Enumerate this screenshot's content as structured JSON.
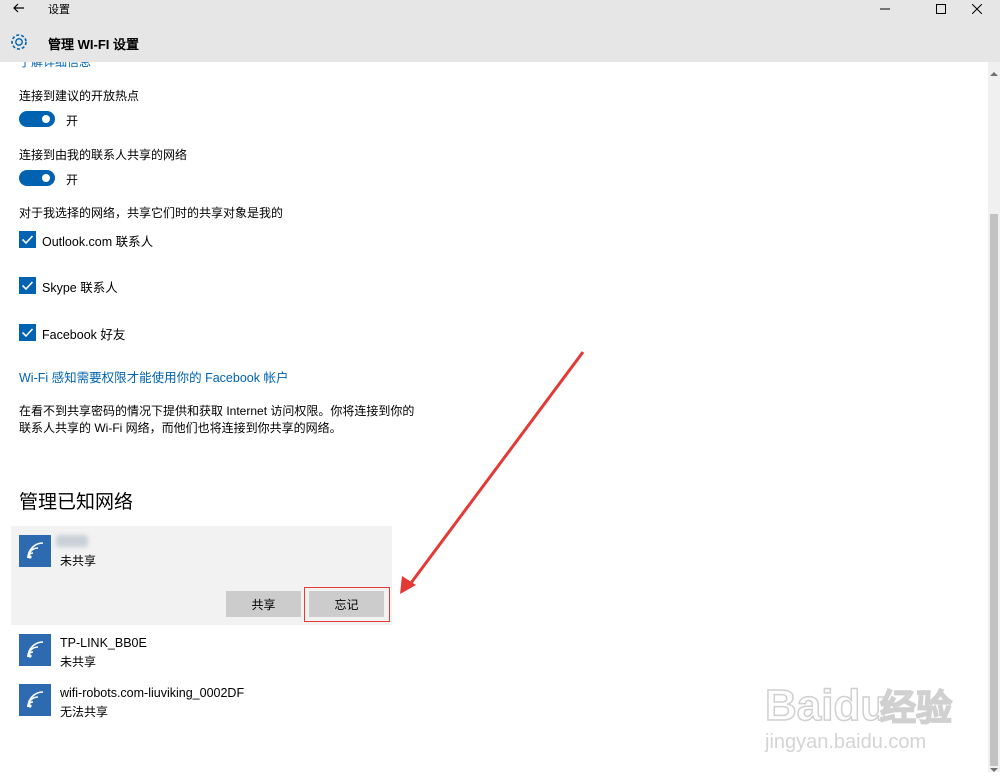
{
  "window": {
    "title": "设置"
  },
  "header": {
    "title": "管理 WI-FI 设置"
  },
  "settings": {
    "cut_link": "了解详细信息",
    "hotspot_label": "连接到建议的开放热点",
    "hotspot_state": "开",
    "contacts_label": "连接到由我的联系人共享的网络",
    "contacts_state": "开",
    "share_label": "对于我选择的网络，共享它们时的共享对象是我的",
    "checks": [
      {
        "label": "Outlook.com 联系人",
        "checked": true
      },
      {
        "label": "Skype 联系人",
        "checked": true
      },
      {
        "label": "Facebook 好友",
        "checked": true
      }
    ],
    "facebook_link": "Wi-Fi 感知需要权限才能使用你的 Facebook 帐户",
    "description": "在看不到共享密码的情况下提供和获取 Internet 访问权限。你将连接到你的联系人共享的 Wi-Fi 网络，而他们也将连接到你共享的网络。"
  },
  "known_networks": {
    "heading": "管理已知网络",
    "items": [
      {
        "name": "",
        "status": "未共享",
        "selected": true
      },
      {
        "name": "TP-LINK_BB0E",
        "status": "未共享"
      },
      {
        "name": "wifi-robots.com-liuviking_0002DF",
        "status": "无法共享"
      }
    ],
    "share_button": "共享",
    "forget_button": "忘记"
  },
  "watermark": {
    "brand": "Baidu",
    "brand_cn": "经验",
    "url": "jingyan.baidu.com"
  },
  "colors": {
    "accent": "#0063b1",
    "tile": "#2d6ab0",
    "annotation": "#e53935"
  }
}
